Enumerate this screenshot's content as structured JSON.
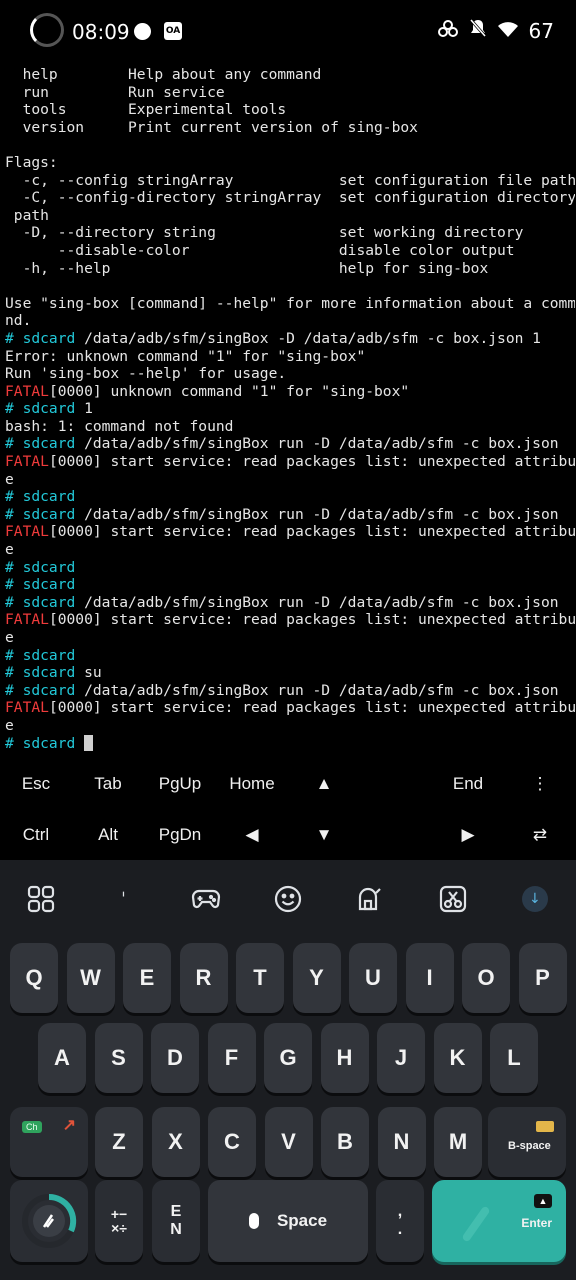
{
  "status_bar": {
    "time": "08:09",
    "battery": "67"
  },
  "terminal": {
    "lines": [
      {
        "text": "  help        Help about any command",
        "type": "plain"
      },
      {
        "text": "  run         Run service",
        "type": "plain"
      },
      {
        "text": "  tools       Experimental tools",
        "type": "plain"
      },
      {
        "text": "  version     Print current version of sing-box",
        "type": "plain"
      },
      {
        "text": "",
        "type": "plain"
      },
      {
        "text": "Flags:",
        "type": "plain"
      },
      {
        "text": "  -c, --config stringArray            set configuration file path",
        "type": "plain"
      },
      {
        "text": "  -C, --config-directory stringArray  set configuration directory",
        "type": "plain"
      },
      {
        "text": " path",
        "type": "plain"
      },
      {
        "text": "  -D, --directory string              set working directory",
        "type": "plain"
      },
      {
        "text": "      --disable-color                 disable color output",
        "type": "plain"
      },
      {
        "text": "  -h, --help                          help for sing-box",
        "type": "plain"
      },
      {
        "text": "",
        "type": "plain"
      },
      {
        "text": "Use \"sing-box [command] --help\" for more information about a comma",
        "type": "plain"
      },
      {
        "text": "nd.",
        "type": "plain"
      },
      {
        "prompt": "# sdcard",
        "text": " /data/adb/sfm/singBox -D /data/adb/sfm -c box.json 1",
        "type": "prompt"
      },
      {
        "text": "Error: unknown command \"1\" for \"sing-box\"",
        "type": "plain"
      },
      {
        "text": "Run 'sing-box --help' for usage.",
        "type": "plain"
      },
      {
        "prefix": "FATAL",
        "text": "[0000] unknown command \"1\" for \"sing-box\"",
        "type": "fatal"
      },
      {
        "prompt": "# sdcard",
        "text": " 1",
        "type": "prompt"
      },
      {
        "text": "bash: 1: command not found",
        "type": "plain"
      },
      {
        "prompt": "# sdcard",
        "text": " /data/adb/sfm/singBox run -D /data/adb/sfm -c box.json",
        "type": "prompt"
      },
      {
        "prefix": "FATAL",
        "text": "[0000] start service: read packages list: unexpected attribut",
        "type": "fatal"
      },
      {
        "text": "e",
        "type": "plain"
      },
      {
        "prompt": "# sdcard",
        "text": "",
        "type": "prompt"
      },
      {
        "prompt": "# sdcard",
        "text": " /data/adb/sfm/singBox run -D /data/adb/sfm -c box.json",
        "type": "prompt"
      },
      {
        "prefix": "FATAL",
        "text": "[0000] start service: read packages list: unexpected attribut",
        "type": "fatal"
      },
      {
        "text": "e",
        "type": "plain"
      },
      {
        "prompt": "# sdcard",
        "text": "",
        "type": "prompt"
      },
      {
        "prompt": "# sdcard",
        "text": "",
        "type": "prompt"
      },
      {
        "prompt": "# sdcard",
        "text": " /data/adb/sfm/singBox run -D /data/adb/sfm -c box.json",
        "type": "prompt"
      },
      {
        "prefix": "FATAL",
        "text": "[0000] start service: read packages list: unexpected attribut",
        "type": "fatal"
      },
      {
        "text": "e",
        "type": "plain"
      },
      {
        "prompt": "# sdcard",
        "text": "",
        "type": "prompt"
      },
      {
        "prompt": "# sdcard",
        "text": " su",
        "type": "prompt"
      },
      {
        "prompt": "# sdcard",
        "text": " /data/adb/sfm/singBox run -D /data/adb/sfm -c box.json",
        "type": "prompt"
      },
      {
        "prefix": "FATAL",
        "text": "[0000] start service: read packages list: unexpected attribut",
        "type": "fatal"
      },
      {
        "text": "e",
        "type": "plain"
      },
      {
        "prompt": "# sdcard",
        "text": " ",
        "type": "prompt",
        "cursor": true
      }
    ]
  },
  "extra_keys": {
    "row1": [
      "Esc",
      "Tab",
      "PgUp",
      "Home",
      "▲",
      "",
      "End",
      "⋮"
    ],
    "row2": [
      "Ctrl",
      "Alt",
      "PgDn",
      "◀",
      "▼",
      "",
      "▶",
      "⇄"
    ]
  },
  "keyboard": {
    "row1": [
      "Q",
      "W",
      "E",
      "R",
      "T",
      "Y",
      "U",
      "I",
      "O",
      "P"
    ],
    "row2": [
      "A",
      "S",
      "D",
      "F",
      "G",
      "H",
      "J",
      "K",
      "L"
    ],
    "row3": [
      "Z",
      "X",
      "C",
      "V",
      "B",
      "N",
      "M"
    ],
    "ch_label": "Ch",
    "backspace_label": "B-space",
    "symbols_label": "+−\n×÷",
    "lang_label": "E\nN",
    "space_label": "Space",
    "punct_label": ",\n.",
    "enter_label": "Enter"
  }
}
